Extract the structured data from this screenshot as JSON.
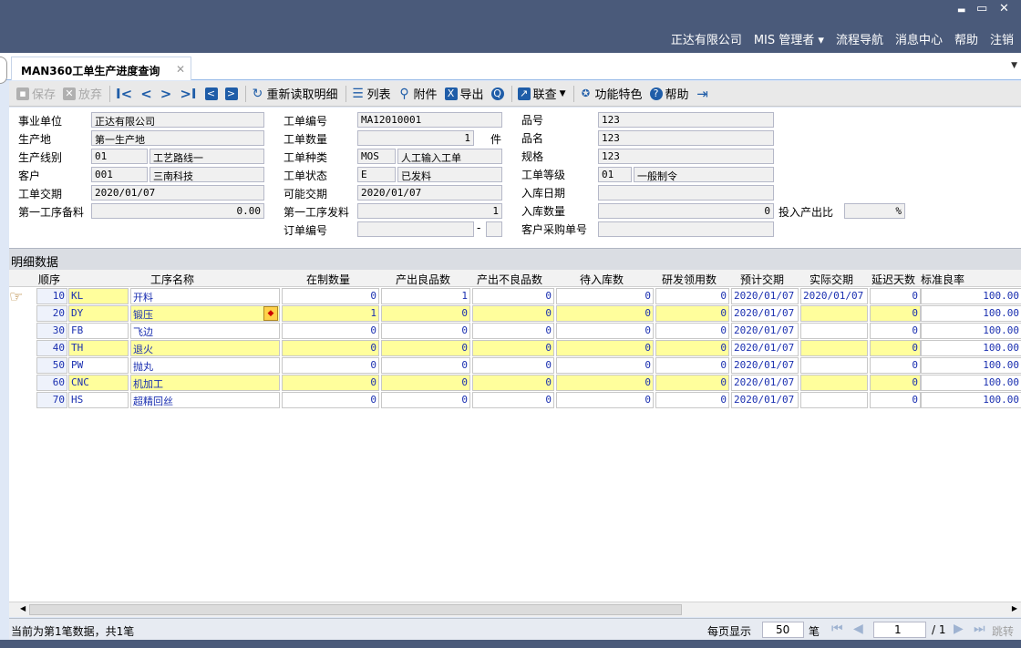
{
  "window": {
    "minimize": "▬",
    "restore": "▭",
    "close": "✕"
  },
  "topnav": {
    "company": "正达有限公司",
    "user": "MIS 管理者",
    "user_caret": "▾",
    "flow_nav": "流程导航",
    "messages": "消息中心",
    "help": "帮助",
    "logout": "注销"
  },
  "tab": {
    "title": "MAN360工单生产进度查询",
    "close": "✕",
    "menu": "▼"
  },
  "toolbar": {
    "save": "保存",
    "discard": "放弃",
    "first": "I<",
    "prev": "<",
    "next": ">",
    "last": ">I",
    "prev_page": "<",
    "next_page": ">",
    "reload_detail": "重新读取明细",
    "list": "列表",
    "attach": "附件",
    "export": "导出",
    "query": "Q",
    "linked_query": "联查",
    "features": "功能特色",
    "help": "帮助",
    "exit": "⇥"
  },
  "form": {
    "business_unit_label": "事业单位",
    "business_unit": "正达有限公司",
    "site_label": "生产地",
    "site": "第一生产地",
    "line_label": "生产线别",
    "line_code": "01",
    "line_name": "工艺路线一",
    "customer_label": "客户",
    "customer_code": "001",
    "customer_name": "三南科技",
    "due_label": "工单交期",
    "due": "2020/01/07",
    "first_prep_label": "第一工序备料",
    "first_prep": "0.00",
    "wo_no_label": "工单编号",
    "wo_no": "MA12010001",
    "wo_qty_label": "工单数量",
    "wo_qty": "1",
    "wo_qty_unit": "件",
    "wo_type_label": "工单种类",
    "wo_type_code": "MOS",
    "wo_type_name": "人工输入工单",
    "wo_status_label": "工单状态",
    "wo_status_code": "E",
    "wo_status_name": "已发料",
    "possible_due_label": "可能交期",
    "possible_due": "2020/01/07",
    "first_issue_label": "第一工序发料",
    "first_issue": "1",
    "order_no_label": "订单编号",
    "order_no": "",
    "order_dash": "-",
    "part_no_label": "品号",
    "part_no": "123",
    "part_name_label": "品名",
    "part_name": "123",
    "spec_label": "规格",
    "spec": "123",
    "wo_level_label": "工单等级",
    "wo_level_code": "01",
    "wo_level_name": "一般制令",
    "in_date_label": "入库日期",
    "in_date": "",
    "in_qty_label": "入库数量",
    "in_qty": "0",
    "io_ratio_label": "投入产出比",
    "io_ratio": "",
    "io_ratio_unit": "%",
    "cust_po_label": "客户采购单号",
    "cust_po": ""
  },
  "detail": {
    "title": "明细数据",
    "pointer_icon": "☞",
    "columns": [
      "顺序",
      "工序名称",
      "在制数量",
      "产出良品数",
      "产出不良品数",
      "待入库数",
      "研发领用数",
      "预计交期",
      "实际交期",
      "延迟天数",
      "标准良率"
    ],
    "rows": [
      {
        "seq": "10",
        "code": "KL",
        "name": "开料",
        "wip": "0",
        "good": "1",
        "bad": "0",
        "pending": "0",
        "rd": "0",
        "plan": "2020/01/07",
        "actual": "2020/01/07",
        "delay": "0",
        "rate": "100.00"
      },
      {
        "seq": "20",
        "code": "DY",
        "name": "锻压",
        "wip": "1",
        "good": "0",
        "bad": "0",
        "pending": "0",
        "rd": "0",
        "plan": "2020/01/07",
        "actual": "",
        "delay": "0",
        "rate": "100.00"
      },
      {
        "seq": "30",
        "code": "FB",
        "name": "飞边",
        "wip": "0",
        "good": "0",
        "bad": "0",
        "pending": "0",
        "rd": "0",
        "plan": "2020/01/07",
        "actual": "",
        "delay": "0",
        "rate": "100.00"
      },
      {
        "seq": "40",
        "code": "TH",
        "name": "退火",
        "wip": "0",
        "good": "0",
        "bad": "0",
        "pending": "0",
        "rd": "0",
        "plan": "2020/01/07",
        "actual": "",
        "delay": "0",
        "rate": "100.00"
      },
      {
        "seq": "50",
        "code": "PW",
        "name": "抛丸",
        "wip": "0",
        "good": "0",
        "bad": "0",
        "pending": "0",
        "rd": "0",
        "plan": "2020/01/07",
        "actual": "",
        "delay": "0",
        "rate": "100.00"
      },
      {
        "seq": "60",
        "code": "CNC",
        "name": "机加工",
        "wip": "0",
        "good": "0",
        "bad": "0",
        "pending": "0",
        "rd": "0",
        "plan": "2020/01/07",
        "actual": "",
        "delay": "0",
        "rate": "100.00"
      },
      {
        "seq": "70",
        "code": "HS",
        "name": "超精回丝",
        "wip": "0",
        "good": "0",
        "bad": "0",
        "pending": "0",
        "rd": "0",
        "plan": "2020/01/07",
        "actual": "",
        "delay": "0",
        "rate": "100.00"
      }
    ]
  },
  "status": {
    "record_info": "当前为第1笔数据，共1笔",
    "per_page_label": "每页显示",
    "per_page": "50",
    "per_page_unit": "笔",
    "page": "1",
    "page_total": "/ 1",
    "go": "跳转"
  },
  "colors": {
    "header_bg": "#4a5a7a",
    "accent": "#1f5da8",
    "row_yellow": "#fffe9c",
    "link_blue": "#1a2fb0"
  }
}
